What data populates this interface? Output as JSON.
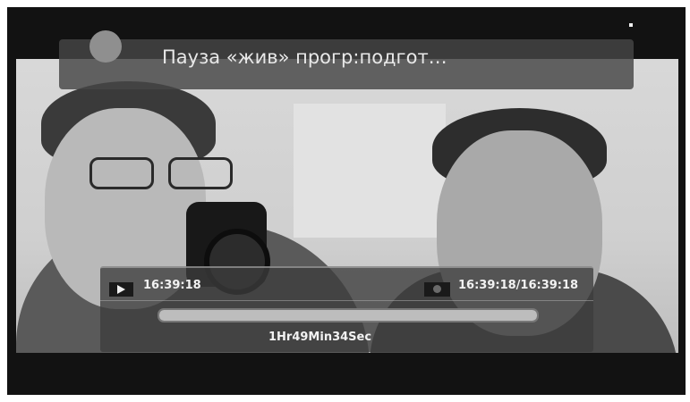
{
  "header": {
    "status_text": "Пауза «жив» прогр:подгот…"
  },
  "player": {
    "current_time": "16:39:18",
    "record_time": "16:39:18/16:39:18",
    "duration": "1Hr49Min34Sec",
    "progress_fraction": 1.0
  },
  "icons": {
    "play": "play-icon",
    "record": "record-icon",
    "status": "status-circle-icon"
  }
}
